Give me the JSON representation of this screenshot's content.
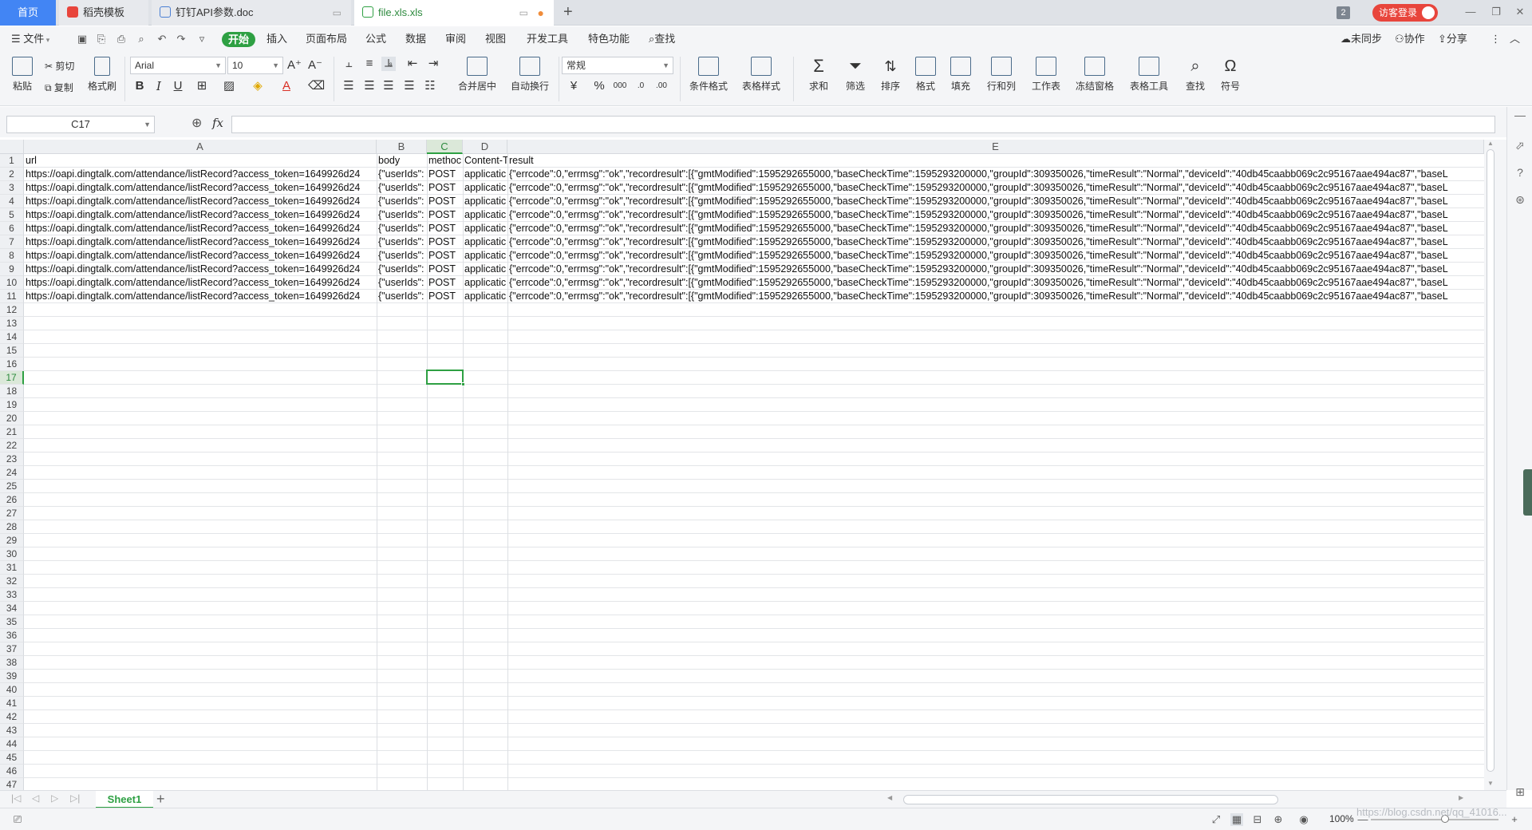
{
  "tabs": {
    "home": "首页",
    "t1": "稻壳模板",
    "t2": "钉钉API参数.doc",
    "t3": "file.xls.xls",
    "badge": "2",
    "visitor": "访客登录"
  },
  "menu": {
    "file": "文件",
    "items": [
      "开始",
      "插入",
      "页面布局",
      "公式",
      "数据",
      "审阅",
      "视图",
      "开发工具",
      "特色功能"
    ],
    "search": "查找",
    "sync": "未同步",
    "collab": "协作",
    "share": "分享"
  },
  "ribbon": {
    "paste": "粘贴",
    "cut": "剪切",
    "copy": "复制",
    "format_painter": "格式刷",
    "font_name": "Arial",
    "font_size": "10",
    "merge_center": "合并居中",
    "wrap": "自动换行",
    "number_format": "常规",
    "cond_format": "条件格式",
    "table_style": "表格样式",
    "sum": "求和",
    "filter": "筛选",
    "sort": "排序",
    "format": "格式",
    "fill": "填充",
    "rowcol": "行和列",
    "sheet": "工作表",
    "freeze": "冻结窗格",
    "table_tools": "表格工具",
    "find": "查找",
    "symbol": "符号"
  },
  "formula": {
    "namebox": "C17",
    "fx": "fx",
    "value": ""
  },
  "grid": {
    "columns": [
      "A",
      "B",
      "C",
      "D",
      "E"
    ],
    "selected_col": "C",
    "selected_row": 17,
    "row_numbers": [
      "1",
      "2",
      "3",
      "4",
      "5",
      "6",
      "7",
      "8",
      "9",
      "10",
      "11",
      "12",
      "13",
      "14",
      "15",
      "16",
      "17",
      "18",
      "19",
      "20",
      "21",
      "22",
      "23",
      "24",
      "25",
      "26",
      "27",
      "28",
      "29",
      "30",
      "31",
      "32",
      "33",
      "34",
      "35",
      "36",
      "37",
      "38",
      "39",
      "40",
      "41",
      "42",
      "43",
      "44",
      "45",
      "46",
      "47"
    ],
    "header_row": [
      "url",
      "body",
      "methoc",
      "Content-T",
      "result"
    ],
    "data_rows": [
      [
        "https://oapi.dingtalk.com/attendance/listRecord?access_token=1649926d24",
        "{\"userIds\":",
        "POST",
        "applicatic",
        "{\"errcode\":0,\"errmsg\":\"ok\",\"recordresult\":[{\"gmtModified\":1595292655000,\"baseCheckTime\":1595293200000,\"groupId\":309350026,\"timeResult\":\"Normal\",\"deviceId\":\"40db45caabb069c2c95167aae494ac87\",\"baseL"
      ],
      [
        "https://oapi.dingtalk.com/attendance/listRecord?access_token=1649926d24",
        "{\"userIds\":",
        "POST",
        "applicatic",
        "{\"errcode\":0,\"errmsg\":\"ok\",\"recordresult\":[{\"gmtModified\":1595292655000,\"baseCheckTime\":1595293200000,\"groupId\":309350026,\"timeResult\":\"Normal\",\"deviceId\":\"40db45caabb069c2c95167aae494ac87\",\"baseL"
      ],
      [
        "https://oapi.dingtalk.com/attendance/listRecord?access_token=1649926d24",
        "{\"userIds\":",
        "POST",
        "applicatic",
        "{\"errcode\":0,\"errmsg\":\"ok\",\"recordresult\":[{\"gmtModified\":1595292655000,\"baseCheckTime\":1595293200000,\"groupId\":309350026,\"timeResult\":\"Normal\",\"deviceId\":\"40db45caabb069c2c95167aae494ac87\",\"baseL"
      ],
      [
        "https://oapi.dingtalk.com/attendance/listRecord?access_token=1649926d24",
        "{\"userIds\":",
        "POST",
        "applicatic",
        "{\"errcode\":0,\"errmsg\":\"ok\",\"recordresult\":[{\"gmtModified\":1595292655000,\"baseCheckTime\":1595293200000,\"groupId\":309350026,\"timeResult\":\"Normal\",\"deviceId\":\"40db45caabb069c2c95167aae494ac87\",\"baseL"
      ],
      [
        "https://oapi.dingtalk.com/attendance/listRecord?access_token=1649926d24",
        "{\"userIds\":",
        "POST",
        "applicatic",
        "{\"errcode\":0,\"errmsg\":\"ok\",\"recordresult\":[{\"gmtModified\":1595292655000,\"baseCheckTime\":1595293200000,\"groupId\":309350026,\"timeResult\":\"Normal\",\"deviceId\":\"40db45caabb069c2c95167aae494ac87\",\"baseL"
      ],
      [
        "https://oapi.dingtalk.com/attendance/listRecord?access_token=1649926d24",
        "{\"userIds\":",
        "POST",
        "applicatic",
        "{\"errcode\":0,\"errmsg\":\"ok\",\"recordresult\":[{\"gmtModified\":1595292655000,\"baseCheckTime\":1595293200000,\"groupId\":309350026,\"timeResult\":\"Normal\",\"deviceId\":\"40db45caabb069c2c95167aae494ac87\",\"baseL"
      ],
      [
        "https://oapi.dingtalk.com/attendance/listRecord?access_token=1649926d24",
        "{\"userIds\":",
        "POST",
        "applicatic",
        "{\"errcode\":0,\"errmsg\":\"ok\",\"recordresult\":[{\"gmtModified\":1595292655000,\"baseCheckTime\":1595293200000,\"groupId\":309350026,\"timeResult\":\"Normal\",\"deviceId\":\"40db45caabb069c2c95167aae494ac87\",\"baseL"
      ],
      [
        "https://oapi.dingtalk.com/attendance/listRecord?access_token=1649926d24",
        "{\"userIds\":",
        "POST",
        "applicatic",
        "{\"errcode\":0,\"errmsg\":\"ok\",\"recordresult\":[{\"gmtModified\":1595292655000,\"baseCheckTime\":1595293200000,\"groupId\":309350026,\"timeResult\":\"Normal\",\"deviceId\":\"40db45caabb069c2c95167aae494ac87\",\"baseL"
      ],
      [
        "https://oapi.dingtalk.com/attendance/listRecord?access_token=1649926d24",
        "{\"userIds\":",
        "POST",
        "applicatic",
        "{\"errcode\":0,\"errmsg\":\"ok\",\"recordresult\":[{\"gmtModified\":1595292655000,\"baseCheckTime\":1595293200000,\"groupId\":309350026,\"timeResult\":\"Normal\",\"deviceId\":\"40db45caabb069c2c95167aae494ac87\",\"baseL"
      ],
      [
        "https://oapi.dingtalk.com/attendance/listRecord?access_token=1649926d24",
        "{\"userIds\":",
        "POST",
        "applicatic",
        "{\"errcode\":0,\"errmsg\":\"ok\",\"recordresult\":[{\"gmtModified\":1595292655000,\"baseCheckTime\":1595293200000,\"groupId\":309350026,\"timeResult\":\"Normal\",\"deviceId\":\"40db45caabb069c2c95167aae494ac87\",\"baseL"
      ]
    ]
  },
  "sheetbar": {
    "sheet_name": "Sheet1"
  },
  "status": {
    "zoom": "100%",
    "watermark": "https://blog.csdn.net/qq_41016..."
  },
  "colors": {
    "accent": "#2ea043",
    "home_tab": "#4285f4",
    "visitor": "#e8453c"
  }
}
